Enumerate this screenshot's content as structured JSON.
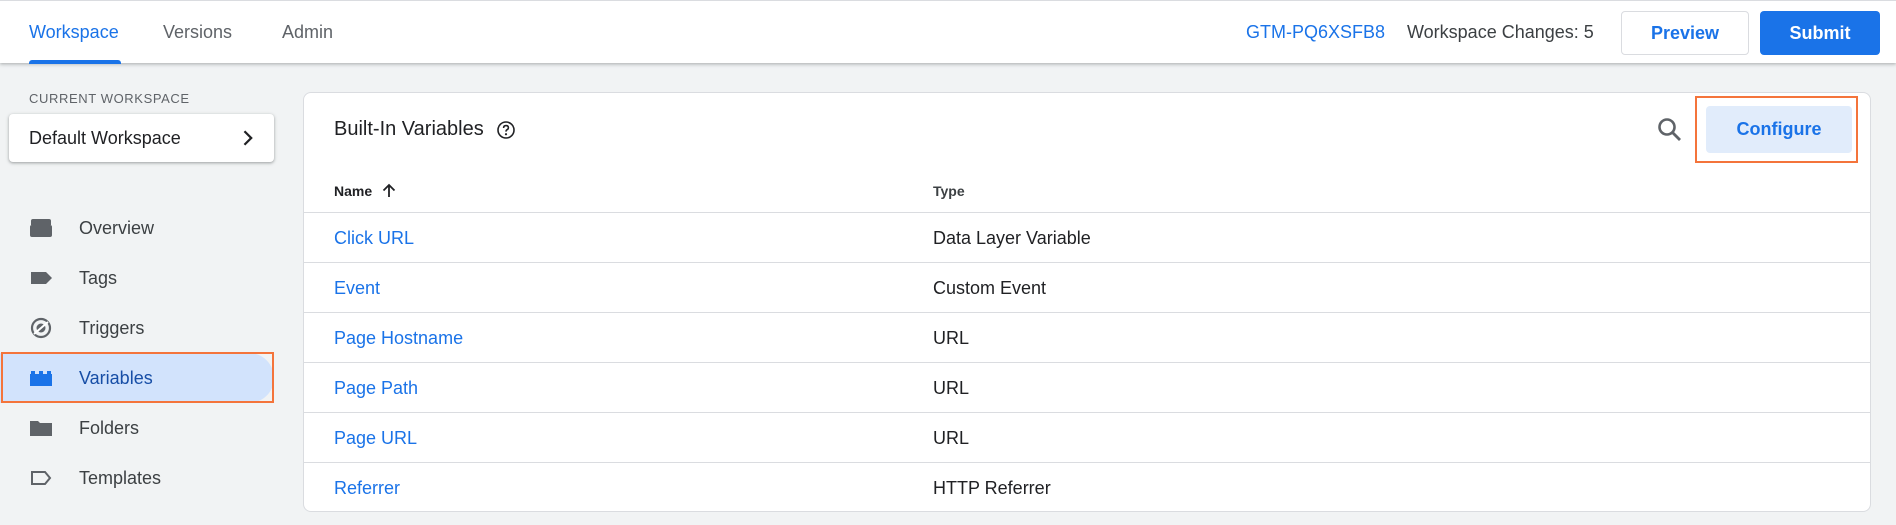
{
  "header": {
    "tabs": [
      {
        "label": "Workspace",
        "active": true
      },
      {
        "label": "Versions",
        "active": false
      },
      {
        "label": "Admin",
        "active": false
      }
    ],
    "container_id": "GTM-PQ6XSFB8",
    "workspace_changes": "Workspace Changes: 5",
    "preview_label": "Preview",
    "submit_label": "Submit"
  },
  "sidebar": {
    "current_workspace_label": "CURRENT WORKSPACE",
    "workspace_name": "Default Workspace",
    "items": [
      {
        "label": "Overview",
        "icon": "overview-icon"
      },
      {
        "label": "Tags",
        "icon": "tag-icon"
      },
      {
        "label": "Triggers",
        "icon": "trigger-icon"
      },
      {
        "label": "Variables",
        "icon": "variables-icon",
        "active": true
      },
      {
        "label": "Folders",
        "icon": "folder-icon"
      },
      {
        "label": "Templates",
        "icon": "template-icon"
      }
    ]
  },
  "main": {
    "title": "Built-In Variables",
    "configure_label": "Configure",
    "columns": {
      "name": "Name",
      "type": "Type"
    },
    "rows": [
      {
        "name": "Click URL",
        "type": "Data Layer Variable"
      },
      {
        "name": "Event",
        "type": "Custom Event"
      },
      {
        "name": "Page Hostname",
        "type": "URL"
      },
      {
        "name": "Page Path",
        "type": "URL"
      },
      {
        "name": "Page URL",
        "type": "URL"
      },
      {
        "name": "Referrer",
        "type": "HTTP Referrer"
      }
    ]
  },
  "colors": {
    "accent": "#1a73e8",
    "highlight": "#f4743b",
    "active_nav_bg": "#d2e3fc",
    "configure_bg": "#e1ecfb"
  }
}
